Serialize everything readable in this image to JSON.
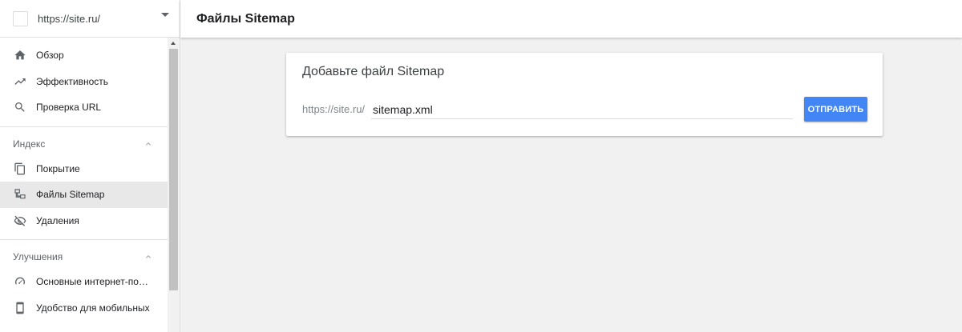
{
  "property": {
    "url": "https://site.ru/"
  },
  "header": {
    "title": "Файлы Sitemap"
  },
  "sidebar": {
    "top_items": [
      {
        "label": "Обзор",
        "icon": "home-icon"
      },
      {
        "label": "Эффективность",
        "icon": "trending-up-icon"
      },
      {
        "label": "Проверка URL",
        "icon": "search-icon"
      }
    ],
    "sections": [
      {
        "title": "Индекс",
        "items": [
          {
            "label": "Покрытие",
            "icon": "copy-pages-icon"
          },
          {
            "label": "Файлы Sitemap",
            "icon": "sitemap-icon",
            "active": true
          },
          {
            "label": "Удаления",
            "icon": "eye-off-icon"
          }
        ]
      },
      {
        "title": "Улучшения",
        "items": [
          {
            "label": "Основные интернет-показ...",
            "icon": "speedometer-icon"
          },
          {
            "label": "Удобство для мобильных",
            "icon": "smartphone-icon"
          }
        ]
      }
    ]
  },
  "card": {
    "title": "Добавьте файл Sitemap",
    "url_prefix": "https://site.ru/",
    "input_value": "sitemap.xml",
    "submit_label": "ОТПРАВИТЬ"
  },
  "colors": {
    "accent": "#4285f4",
    "active_bg": "#e8e8e8"
  }
}
